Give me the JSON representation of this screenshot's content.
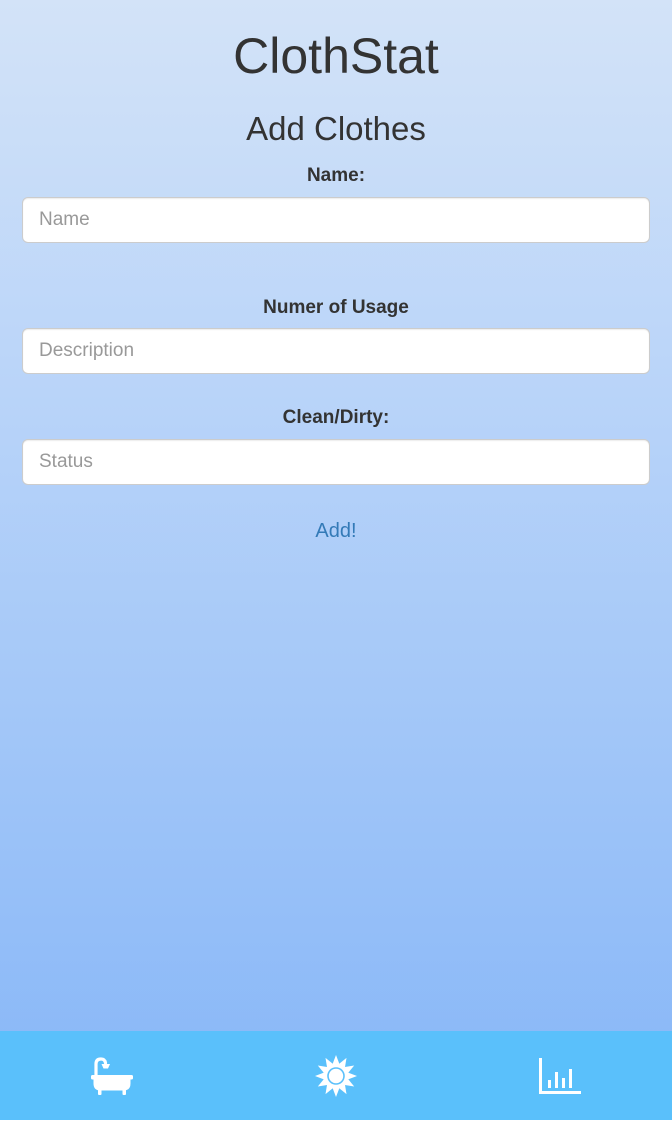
{
  "app": {
    "title": "ClothStat"
  },
  "form": {
    "title": "Add Clothes",
    "fields": [
      {
        "label": "Name:",
        "placeholder": "Name",
        "value": ""
      },
      {
        "label": "Numer of Usage",
        "placeholder": "Description",
        "value": ""
      },
      {
        "label": "Clean/Dirty:",
        "placeholder": "Status",
        "value": ""
      }
    ],
    "submit_label": "Add!"
  },
  "tab_bar": {
    "background": "#5ac0fb",
    "tabs": [
      {
        "icon": "bathtub-icon"
      },
      {
        "icon": "sun-icon"
      },
      {
        "icon": "bar-chart-icon"
      }
    ]
  },
  "colors": {
    "link": "#337ab7",
    "text": "#333333"
  }
}
